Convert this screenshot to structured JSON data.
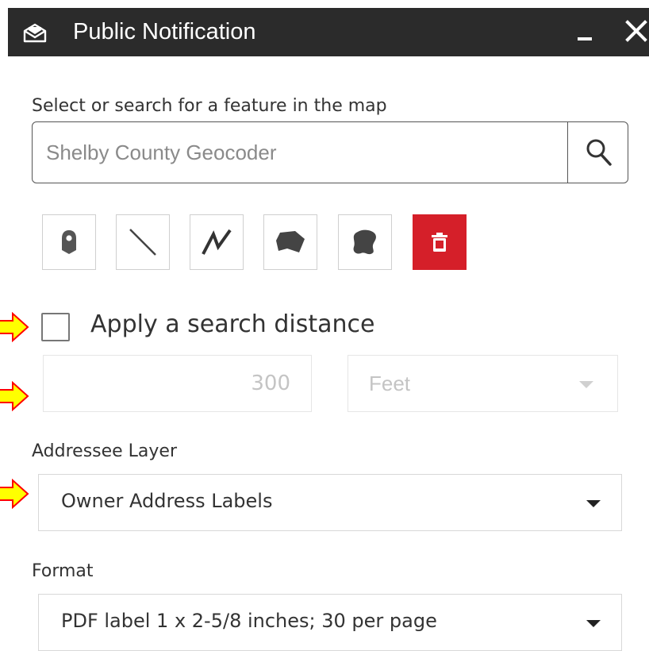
{
  "header": {
    "title": "Public Notification",
    "icon": "envelope-icon"
  },
  "search": {
    "label": "Select or search for a feature in the map",
    "placeholder": "Shelby County Geocoder"
  },
  "tools": [
    {
      "name": "point",
      "icon": "map-pin-icon"
    },
    {
      "name": "line",
      "icon": "line-icon"
    },
    {
      "name": "polyline",
      "icon": "polyline-icon"
    },
    {
      "name": "polygon",
      "icon": "polygon-icon"
    },
    {
      "name": "freehand-polygon",
      "icon": "freehand-polygon-icon"
    },
    {
      "name": "clear",
      "icon": "trash-icon"
    }
  ],
  "buffer": {
    "checkbox_label": "Apply a search distance",
    "checked": false,
    "distance": "300",
    "unit": "Feet"
  },
  "addressee": {
    "label": "Addressee Layer",
    "value": "Owner Address Labels"
  },
  "format": {
    "label": "Format",
    "value": "PDF label 1 x 2-5/8 inches; 30 per page"
  },
  "colors": {
    "titlebar": "#2b2b2b",
    "clear_button": "#d51f29",
    "arrow_fill": "#ffff00",
    "arrow_stroke": "#ff0000"
  }
}
